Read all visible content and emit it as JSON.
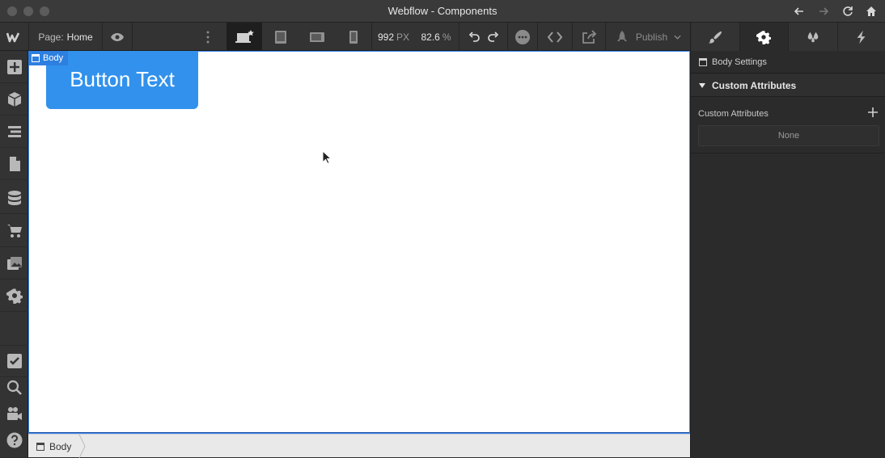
{
  "window": {
    "title": "Webflow - Components"
  },
  "toolbar": {
    "page_label": "Page:",
    "page_value": "Home",
    "width_value": "992",
    "width_unit": "PX",
    "zoom_value": "82.6",
    "zoom_unit": "%",
    "publish_label": "Publish"
  },
  "canvas": {
    "body_tag": "Body",
    "button_text": "Button Text",
    "button_color": "#3191ec"
  },
  "breadcrumb": {
    "item": "Body"
  },
  "panel": {
    "settings_title": "Body Settings",
    "section_title": "Custom Attributes",
    "field_label": "Custom Attributes",
    "empty_value": "None"
  },
  "icons": {
    "left_rail": [
      "add-icon",
      "components-icon",
      "navigator-icon",
      "pages-icon",
      "cms-icon",
      "ecommerce-icon",
      "assets-icon",
      "settings-icon",
      "tasks-icon",
      "search-icon",
      "video-icon",
      "help-icon"
    ],
    "right_tabs": [
      "style-brush-icon",
      "gear-icon",
      "drops-icon",
      "interactions-bolt-icon"
    ]
  },
  "colors": {
    "accent": "#2d7fe0",
    "panel_bg": "#2b2b2b",
    "toolbar_bg": "#333333"
  }
}
